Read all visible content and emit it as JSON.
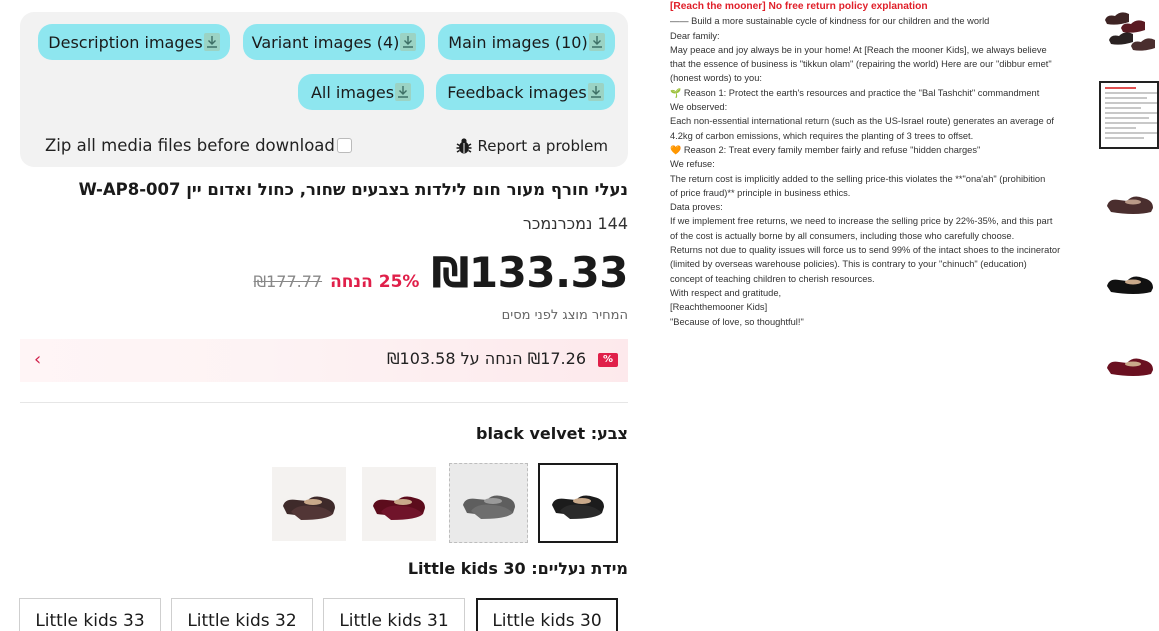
{
  "downloads": {
    "description_images": "Description images",
    "variant_images": "Variant images (4)",
    "main_images": "Main images (10)",
    "all_images": "All images",
    "feedback_images": "Feedback images",
    "zip_label": "Zip all media files before download",
    "zip_checked": false,
    "report_label": "Report a problem"
  },
  "product": {
    "title": "נעלי חורף מעור חום לילדות בצבעים שחור, כחול ואדום יין W-AP8-007",
    "sold": "144 נמכרנמכר",
    "price": "₪133.33",
    "discount": "25% הנחה",
    "original_price": "₪177.77",
    "tax_note": "המחיר מוצג לפני מסים",
    "promo": {
      "badge": "%",
      "text": "₪17.26 הנחה על ₪103.58"
    },
    "color_label": "צבע: black velvet",
    "colors": [
      {
        "name": "black velvet",
        "color": "#1c1c1c",
        "selected": true
      },
      {
        "name": "grey",
        "color": "#6a6a6a",
        "selected": false
      },
      {
        "name": "red velvet",
        "color": "#6a1020",
        "selected": false
      },
      {
        "name": "brown velvet",
        "color": "#4a2e2a",
        "selected": false
      }
    ],
    "size_label": "מידת נעליים: Little kids 30",
    "sizes": [
      "Little kids 30",
      "Little kids 31",
      "Little kids 32",
      "Little kids 33"
    ],
    "selected_size": "Little kids 30"
  },
  "description": {
    "heading": "[Reach the mooner] No free return policy explanation",
    "lines": [
      "—— Build a more sustainable cycle of kindness for our children and the world",
      "",
      "Dear family:",
      "",
      "May peace and joy always be in your home! At [Reach the mooner Kids], we always believe",
      "that the essence of business is \"tikkun olam\" (repairing the world) Here are our \"dibbur emet\"",
      "(honest words) to you:",
      "",
      "Reason 1: Protect the earth's resources and practice the \"Bal Tashchit\" commandment",
      "We observed:",
      "Each non-essential international return (such as the US-Israel route) generates an average of",
      "4.2kg of carbon emissions, which requires the planting of 3 trees to offset.",
      "",
      "Reason 2: Treat every family member fairly and refuse \"hidden charges\"",
      "We refuse:",
      "The return cost is implicitly added to the selling price-this violates the **\"ona'ah\" (prohibition",
      "of price fraud)** principle in business ethics.",
      "",
      "Data proves:",
      "If we implement free returns, we need to increase the selling price by 22%-35%, and this part",
      "of the cost is actually borne by all consumers, including those who carefully choose.",
      "",
      "Returns not due to quality issues will force us to send 99% of the intact shoes to the incinerator",
      "(limited by overseas warehouse policies). This is contrary to your \"chinuch\" (education)",
      "concept of teaching children to cherish resources.",
      "",
      "With respect and gratitude,",
      "[Reachthemooner Kids]",
      "\"Because of love, so thoughtful!\""
    ]
  },
  "thumbnails": [
    {
      "kind": "shoes-group",
      "color": "#4a2626",
      "selected": false
    },
    {
      "kind": "document",
      "selected": true
    },
    {
      "kind": "shoe",
      "color": "#4a2e2e",
      "selected": false
    },
    {
      "kind": "shoe",
      "color": "#111111",
      "selected": false
    },
    {
      "kind": "shoe",
      "color": "#6a1020",
      "selected": false
    }
  ]
}
